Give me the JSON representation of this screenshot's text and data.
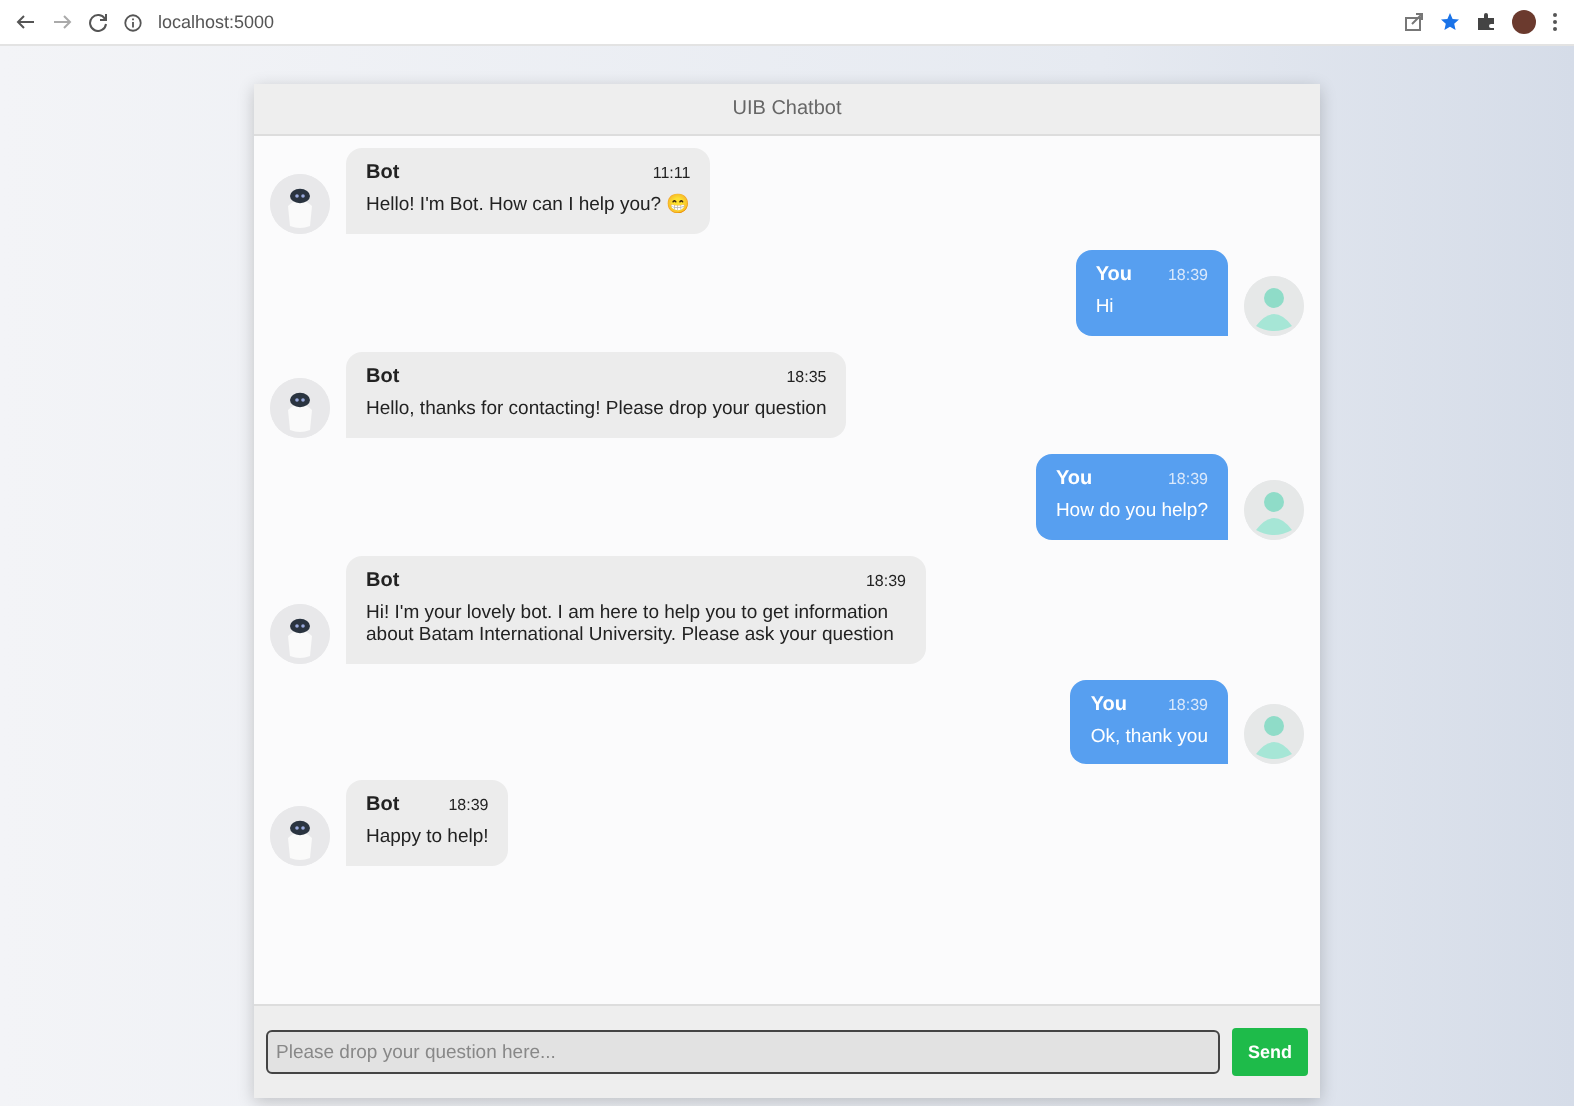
{
  "browser": {
    "url": "localhost:5000"
  },
  "chat": {
    "title": "UIB Chatbot",
    "messages": [
      {
        "kind": "bot",
        "sender": "Bot",
        "time": "11:11",
        "text": "Hello! I'm Bot. How can I help you? 😁"
      },
      {
        "kind": "user",
        "sender": "You",
        "time": "18:39",
        "text": "Hi"
      },
      {
        "kind": "bot",
        "sender": "Bot",
        "time": "18:35",
        "text": "Hello, thanks for contacting! Please drop your question"
      },
      {
        "kind": "user",
        "sender": "You",
        "time": "18:39",
        "text": "How do you help?"
      },
      {
        "kind": "bot",
        "sender": "Bot",
        "time": "18:39",
        "text": "Hi! I'm your lovely bot. I am here to help you to get information about Batam International University. Please ask your question"
      },
      {
        "kind": "user",
        "sender": "You",
        "time": "18:39",
        "text": "Ok, thank you"
      },
      {
        "kind": "bot",
        "sender": "Bot",
        "time": "18:39",
        "text": "Happy to help!"
      }
    ],
    "input": {
      "placeholder": "Please drop your question here..."
    },
    "send_button": "Send"
  }
}
